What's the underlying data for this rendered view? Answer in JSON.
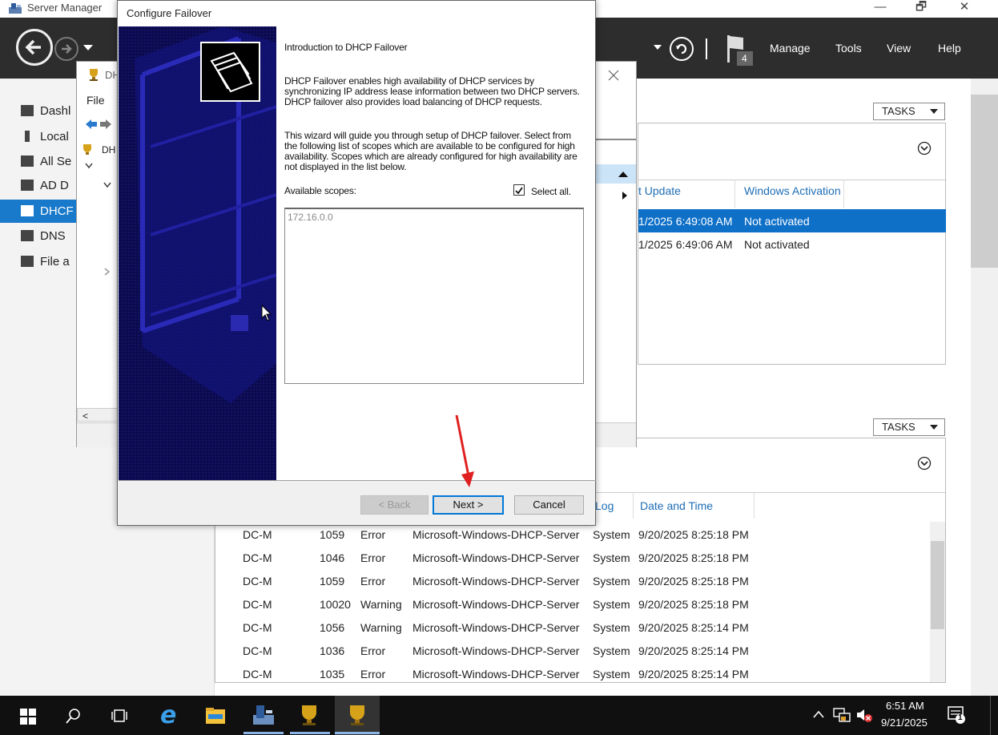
{
  "server_manager": {
    "title": "Server Manager",
    "window_controls": {
      "minimize": "—",
      "maximize": "🗗",
      "close": "✕"
    },
    "menu": {
      "manage": "Manage",
      "tools": "Tools",
      "view": "View",
      "help": "Help"
    },
    "flag_count": "4",
    "sidebar": {
      "items": [
        {
          "label": "Dashl",
          "icon": "dashboard-icon"
        },
        {
          "label": "Local",
          "icon": "local-server-icon"
        },
        {
          "label": "All Se",
          "icon": "all-servers-icon"
        },
        {
          "label": "AD D",
          "icon": "ad-ds-icon"
        },
        {
          "label": "DHCF",
          "icon": "dhcp-icon"
        },
        {
          "label": "DNS",
          "icon": "dns-icon"
        },
        {
          "label": "File a",
          "icon": "file-storage-icon"
        }
      ],
      "active_index": 4
    },
    "tasks_label": "TASKS",
    "servers_grid": {
      "columns": [
        "t Update",
        "Windows Activation"
      ],
      "rows": [
        {
          "update": "1/2025 6:49:08 AM",
          "activation": "Not activated",
          "selected": true
        },
        {
          "update": "1/2025 6:49:06 AM",
          "activation": "Not activated",
          "selected": false
        }
      ]
    },
    "events_grid": {
      "columns": [
        "Log",
        "Date and Time"
      ],
      "col_log_partial": "Log",
      "rows": [
        {
          "server": "DC-M",
          "id": "1059",
          "severity": "Error",
          "source": "Microsoft-Windows-DHCP-Server",
          "log": "System",
          "date": "9/20/2025 8:25:18 PM"
        },
        {
          "server": "DC-M",
          "id": "1046",
          "severity": "Error",
          "source": "Microsoft-Windows-DHCP-Server",
          "log": "System",
          "date": "9/20/2025 8:25:18 PM"
        },
        {
          "server": "DC-M",
          "id": "1059",
          "severity": "Error",
          "source": "Microsoft-Windows-DHCP-Server",
          "log": "System",
          "date": "9/20/2025 8:25:18 PM"
        },
        {
          "server": "DC-M",
          "id": "10020",
          "severity": "Warning",
          "source": "Microsoft-Windows-DHCP-Server",
          "log": "System",
          "date": "9/20/2025 8:25:18 PM"
        },
        {
          "server": "DC-M",
          "id": "1056",
          "severity": "Warning",
          "source": "Microsoft-Windows-DHCP-Server",
          "log": "System",
          "date": "9/20/2025 8:25:14 PM"
        },
        {
          "server": "DC-M",
          "id": "1036",
          "severity": "Error",
          "source": "Microsoft-Windows-DHCP-Server",
          "log": "System",
          "date": "9/20/2025 8:25:14 PM"
        },
        {
          "server": "DC-M",
          "id": "1035",
          "severity": "Error",
          "source": "Microsoft-Windows-DHCP-Server",
          "log": "System",
          "date": "9/20/2025 8:25:14 PM"
        }
      ]
    }
  },
  "dhcp_console": {
    "title": "DH",
    "menu_file": "File",
    "tree_root": "DH"
  },
  "dialog": {
    "title": "Configure Failover",
    "heading": "Introduction to DHCP Failover",
    "para1": "DHCP Failover enables high availability of DHCP services by synchronizing IP address lease information between two DHCP servers. DHCP failover also provides load balancing of DHCP requests.",
    "para2": "This wizard will guide you through setup of DHCP failover. Select from the following list of scopes which are available to be configured for high availability. Scopes which are already configured for high availability are not displayed in the list below.",
    "available_scopes_label": "Available scopes:",
    "select_all_label": "Select all.",
    "select_all_checked": true,
    "scopes": [
      "172.16.0.0"
    ],
    "back_label": "< Back",
    "next_label": "Next >",
    "cancel_label": "Cancel"
  },
  "taskbar": {
    "time": "6:51 AM",
    "date": "9/21/2025",
    "notification_count": "1"
  },
  "colors": {
    "accent": "#0f70c8",
    "toolbar": "#2d2d2d",
    "banner": "#0b0a4e",
    "annotation_arrow": "#e02020"
  }
}
